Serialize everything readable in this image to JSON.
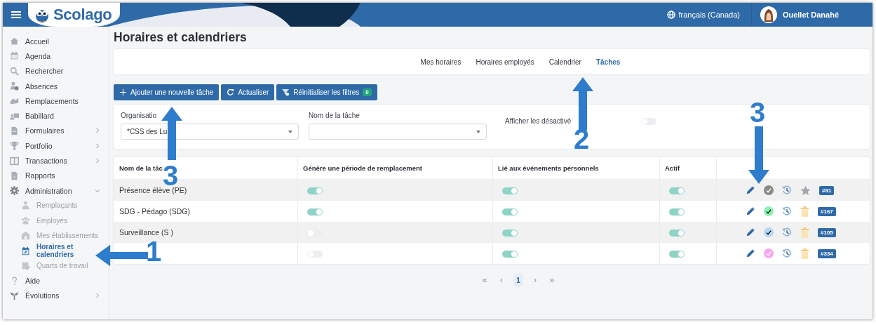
{
  "header": {
    "logo": "Scolago",
    "language": "français (Canada)",
    "user": "Ouellet Danahé"
  },
  "sidebar": {
    "items": [
      {
        "label": "Accueil",
        "selected": false
      },
      {
        "label": "Agenda",
        "selected": false
      },
      {
        "label": "Rechercher",
        "selected": false
      },
      {
        "label": "Absences",
        "selected": false
      },
      {
        "label": "Remplacements",
        "selected": false
      },
      {
        "label": "Babillard",
        "selected": false
      },
      {
        "label": "Formulaires",
        "selected": false,
        "expanded": false
      },
      {
        "label": "Portfolio",
        "selected": false,
        "expanded": false
      },
      {
        "label": "Transactions",
        "selected": false,
        "expanded": false
      },
      {
        "label": "Rapports",
        "selected": false
      },
      {
        "label": "Administration",
        "selected": false,
        "expanded": true,
        "children": [
          {
            "label": "Remplaçants",
            "selected": false
          },
          {
            "label": "Employés",
            "selected": false
          },
          {
            "label": "Mes établissements",
            "selected": false
          },
          {
            "label": "Horaires et calendriers",
            "selected": true
          },
          {
            "label": "Quarts de travail",
            "selected": false
          }
        ]
      },
      {
        "label": "Aide",
        "selected": false
      },
      {
        "label": "Évolutions",
        "selected": false,
        "expanded": false
      }
    ]
  },
  "page_title": "Horaires et calendriers",
  "tabs": [
    {
      "label": "Mes horaires",
      "selected": false
    },
    {
      "label": "Horaires employés",
      "selected": false
    },
    {
      "label": "Calendrier",
      "selected": false
    },
    {
      "label": "Tâches",
      "selected": true
    }
  ],
  "toolbar": {
    "buttons": [
      {
        "kind": "add",
        "label": "Ajouter une nouvelle tâche"
      },
      {
        "kind": "refresh",
        "label": "Actualiser"
      },
      {
        "kind": "reset",
        "label": "Réinitialiser les filtres",
        "badge": "0"
      }
    ]
  },
  "filters": {
    "organisation": {
      "label": "Organisatio",
      "value": "*CSS des Lu"
    },
    "task_name": {
      "label": "Nom de la tâche"
    },
    "show_disabled": {
      "label": "Afficher les désactivé",
      "on": false
    }
  },
  "table": {
    "columns": [
      "Nom de la tâc",
      "Génère une période de remplacement",
      "Lié aux événements personnels",
      "Actif"
    ],
    "rows": [
      {
        "name": "Présence élève (PE)",
        "generates_period": true,
        "linked_personal": true,
        "active": true,
        "color": "#8a8a8a",
        "kind": "star",
        "id": "#81"
      },
      {
        "name": "SDG - Pédago (SDG)",
        "generates_period": true,
        "linked_personal": true,
        "active": true,
        "color": "#8ef0b4",
        "kind": "trash",
        "id": "#167"
      },
      {
        "name": "Surveillance (S )",
        "generates_period": false,
        "linked_personal": true,
        "active": true,
        "color": "#b6d8f5",
        "kind": "trash",
        "id": "#105"
      },
      {
        "generates_period": false,
        "linked_personal": true,
        "active": true,
        "color": "#f7a6ef",
        "kind": "trash",
        "id": "#334"
      }
    ]
  },
  "pagination": [
    {
      "label": "«",
      "selected": false
    },
    {
      "label": "‹",
      "selected": false
    },
    {
      "label": "1",
      "selected": true
    },
    {
      "label": "›",
      "selected": false
    },
    {
      "label": "»",
      "selected": false
    }
  ],
  "annotations": [
    {
      "number": "1",
      "kind": "left"
    },
    {
      "number": "3",
      "kind": "up"
    },
    {
      "number": "2",
      "kind": "up"
    },
    {
      "number": "3",
      "kind": "down"
    }
  ]
}
